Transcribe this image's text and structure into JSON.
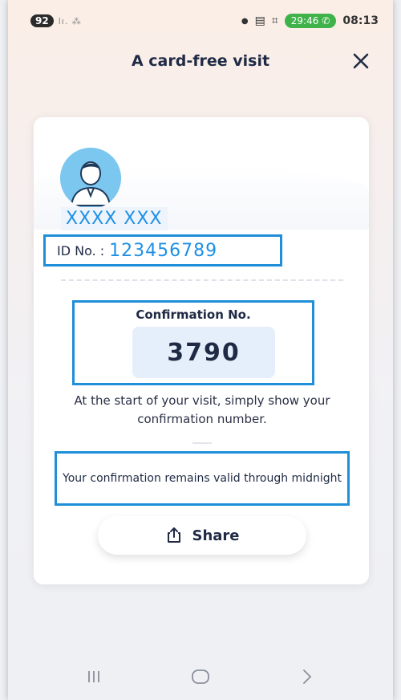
{
  "status_bar": {
    "battery": "92",
    "signal": "lı. ⁂",
    "call_timer": "29:46",
    "time": "08:13"
  },
  "header": {
    "title": "A card-free visit"
  },
  "card": {
    "name": "XXXX XXX",
    "id_label": "ID No. :",
    "id_value": "123456789",
    "confirmation_label": "Confirmation No.",
    "confirmation_number": "3790",
    "instruction": "At the start of your visit, simply show your confirmation number.",
    "validity": "Your confirmation remains valid through midnight",
    "share_label": "Share"
  },
  "colors": {
    "accent": "#1e90e6",
    "highlight_border": "#1e8fd8",
    "text_dark": "#1f2a44",
    "number_bg": "#e4effb",
    "call_green": "#3fb24a"
  },
  "icons": {
    "close": "close-icon",
    "share": "share-icon",
    "avatar": "user-avatar-icon",
    "nav_recent": "recent-apps-icon",
    "nav_home": "home-icon",
    "nav_back": "back-icon"
  }
}
